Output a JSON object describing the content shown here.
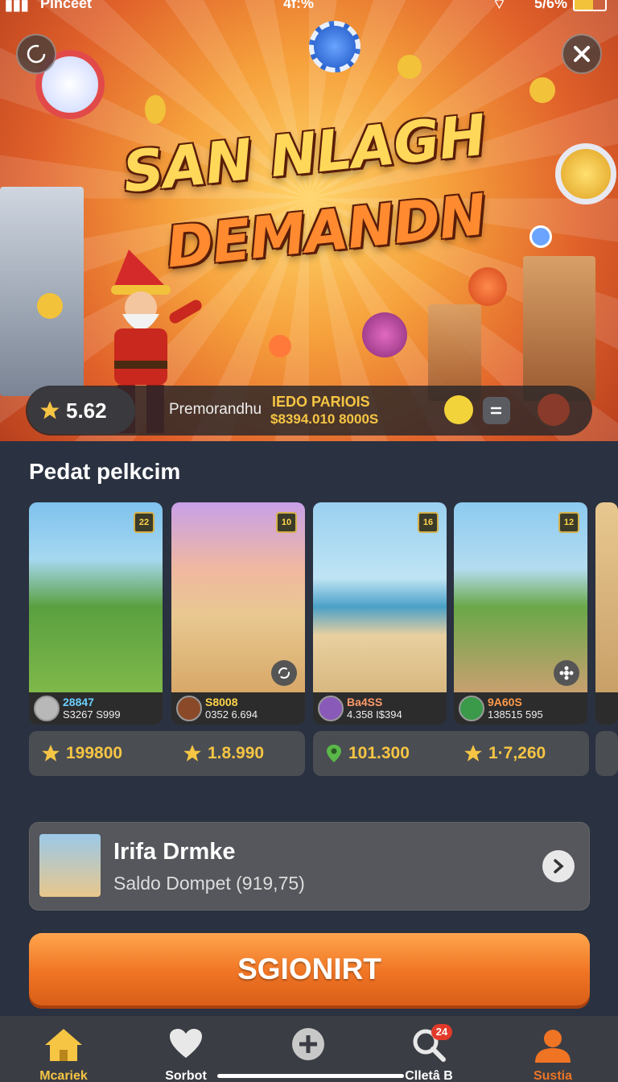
{
  "status_bar": {
    "carrier": "Pinceet",
    "center": "4f:%",
    "battery": "5/6%"
  },
  "hero": {
    "title_line1": "SAN NLAGH",
    "title_line2": "DEMANDN",
    "rating": "5.62",
    "promo_label": "Premorandhu",
    "promo_title": "IEDO PARIOIS",
    "promo_amount": "$8394.010 8000S"
  },
  "section": {
    "title": "Pedat pelkcim"
  },
  "cards": [
    {
      "badge": "22",
      "line1": "28847",
      "line2": "S3267 S999"
    },
    {
      "badge": "10",
      "line1": "S8008",
      "line2": "0352 6.694"
    },
    {
      "badge": "16",
      "line1": "Ba4SS",
      "line2": "4.358 I$394"
    },
    {
      "badge": "12",
      "line1": "9A60S",
      "line2": "138515 595"
    }
  ],
  "prices": [
    "199800",
    "1.8.990",
    "101.300",
    "1·7,260"
  ],
  "wallet": {
    "name": "Irifa Drmke",
    "balance": "Saldo Dompet (919,75)"
  },
  "cta": {
    "label": "SGIONIRT"
  },
  "nav": {
    "items": [
      {
        "label": "Mcariek",
        "icon": "home-icon"
      },
      {
        "label": "Sorbot",
        "icon": "heart-icon"
      },
      {
        "label": "",
        "icon": "plus-icon"
      },
      {
        "label": "Clletâ B",
        "icon": "search-icon",
        "badge": "24"
      },
      {
        "label": "Sustia",
        "icon": "profile-icon"
      }
    ]
  },
  "colors": {
    "accent": "#ef7424",
    "gold": "#f6c544",
    "background": "#2a3140"
  }
}
